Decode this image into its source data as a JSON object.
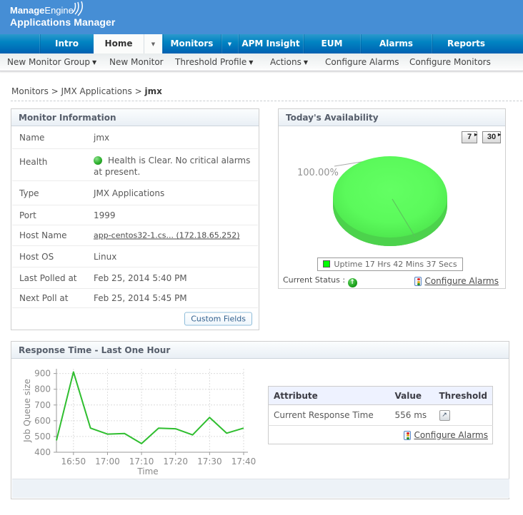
{
  "header": {
    "brand_line1_bold": "Manage",
    "brand_line1_rest": "Engine",
    "brand_line2": "Applications Manager"
  },
  "tabs": {
    "intro": "Intro",
    "home": "Home",
    "monitors": "Monitors",
    "apm": "APM Insight",
    "eum": "EUM",
    "alarms": "Alarms",
    "reports": "Reports"
  },
  "subnav": {
    "new_monitor_group": "New Monitor Group",
    "new_monitor": "New Monitor",
    "threshold_profile": "Threshold Profile",
    "actions": "Actions",
    "configure_alarms": "Configure Alarms",
    "configure_monitors": "Configure Monitors"
  },
  "breadcrumb": {
    "path": "Monitors > JMX Applications > ",
    "current": "jmx"
  },
  "monitor_info": {
    "title": "Monitor Information",
    "name_label": "Name",
    "name_value": "jmx",
    "health_label": "Health",
    "health_value": "Health is Clear. No critical alarms at present.",
    "type_label": "Type",
    "type_value": "JMX Applications",
    "port_label": "Port",
    "port_value": "1999",
    "host_label": "Host Name",
    "host_value": "app-centos32-1.cs... (172.18.65.252)",
    "os_label": "Host OS",
    "os_value": "Linux",
    "last_polled_label": "Last Polled at",
    "last_polled_value": "Feb 25, 2014 5:40 PM",
    "next_poll_label": "Next Poll at",
    "next_poll_value": "Feb 25, 2014 5:45 PM",
    "custom_fields_button": "Custom Fields"
  },
  "availability": {
    "title": "Today's Availability",
    "btn7": "7",
    "btn30": "30",
    "percent_label": "100.00%",
    "legend": "Uptime 17 Hrs 42 Mins 37 Secs",
    "current_status_label": "Current Status : ",
    "status_up_symbol": "↑",
    "configure_alarms": "Configure Alarms",
    "pie_color": "#55ef55"
  },
  "response": {
    "title": "Response Time - Last One Hour",
    "configure_alarms": "Configure Alarms",
    "table": {
      "headers": [
        "Attribute",
        "Value",
        "Threshold"
      ],
      "rows": [
        {
          "attribute": "Current Response Time",
          "value": "556 ms"
        }
      ]
    }
  },
  "chart_data": {
    "type": "line",
    "title": "Response Time - Last One Hour",
    "xlabel": "Time",
    "ylabel": "Job Queue size",
    "x_ticks": [
      "16:50",
      "17:00",
      "17:10",
      "17:20",
      "17:30",
      "17:40"
    ],
    "y_ticks": [
      400,
      500,
      600,
      700,
      800,
      900
    ],
    "ylim": [
      400,
      930
    ],
    "x_minutes": [
      1645,
      1650,
      1655,
      1700,
      1705,
      1710,
      1715,
      1720,
      1725,
      1730,
      1735,
      1740
    ],
    "values": [
      475,
      910,
      553,
      515,
      519,
      455,
      553,
      549,
      510,
      621,
      521,
      553
    ],
    "line_color": "#2fbe2f",
    "grid": true,
    "legend_position": "none"
  }
}
